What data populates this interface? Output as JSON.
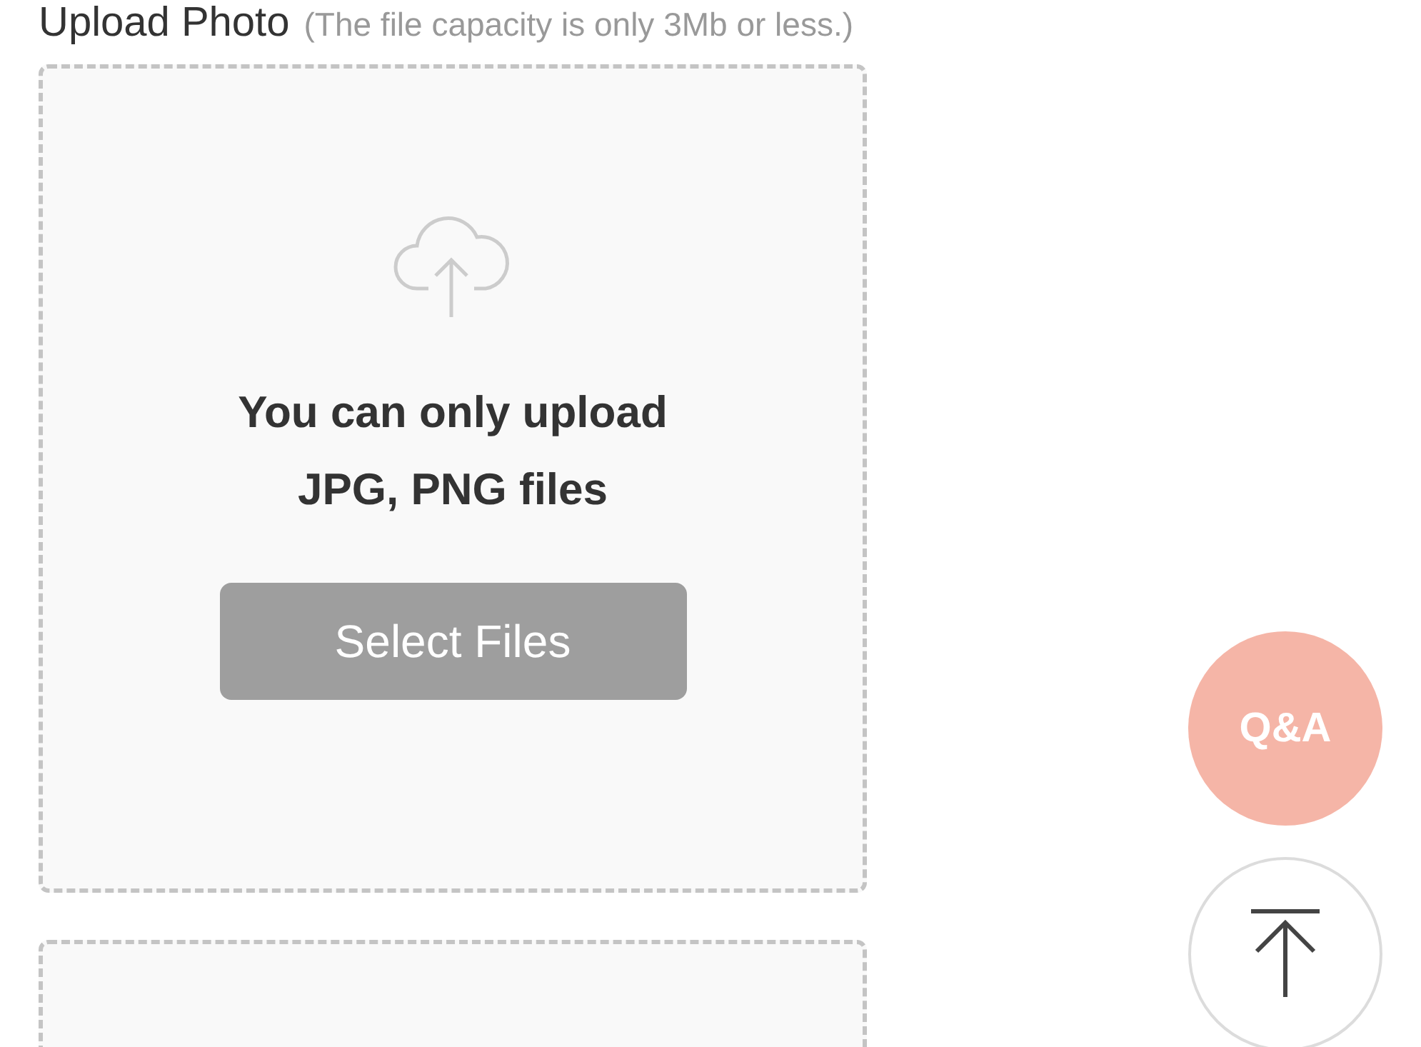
{
  "upload": {
    "title": "Upload Photo",
    "hint": "(The file capacity is only 3Mb or less.)"
  },
  "dropzones": [
    {
      "kind": "prompt",
      "message_lines": [
        "You can only upload",
        "JPG, PNG files"
      ],
      "button": "Select Files"
    },
    {
      "kind": "cut"
    }
  ],
  "floating": {
    "qa_label": "Q&A"
  }
}
